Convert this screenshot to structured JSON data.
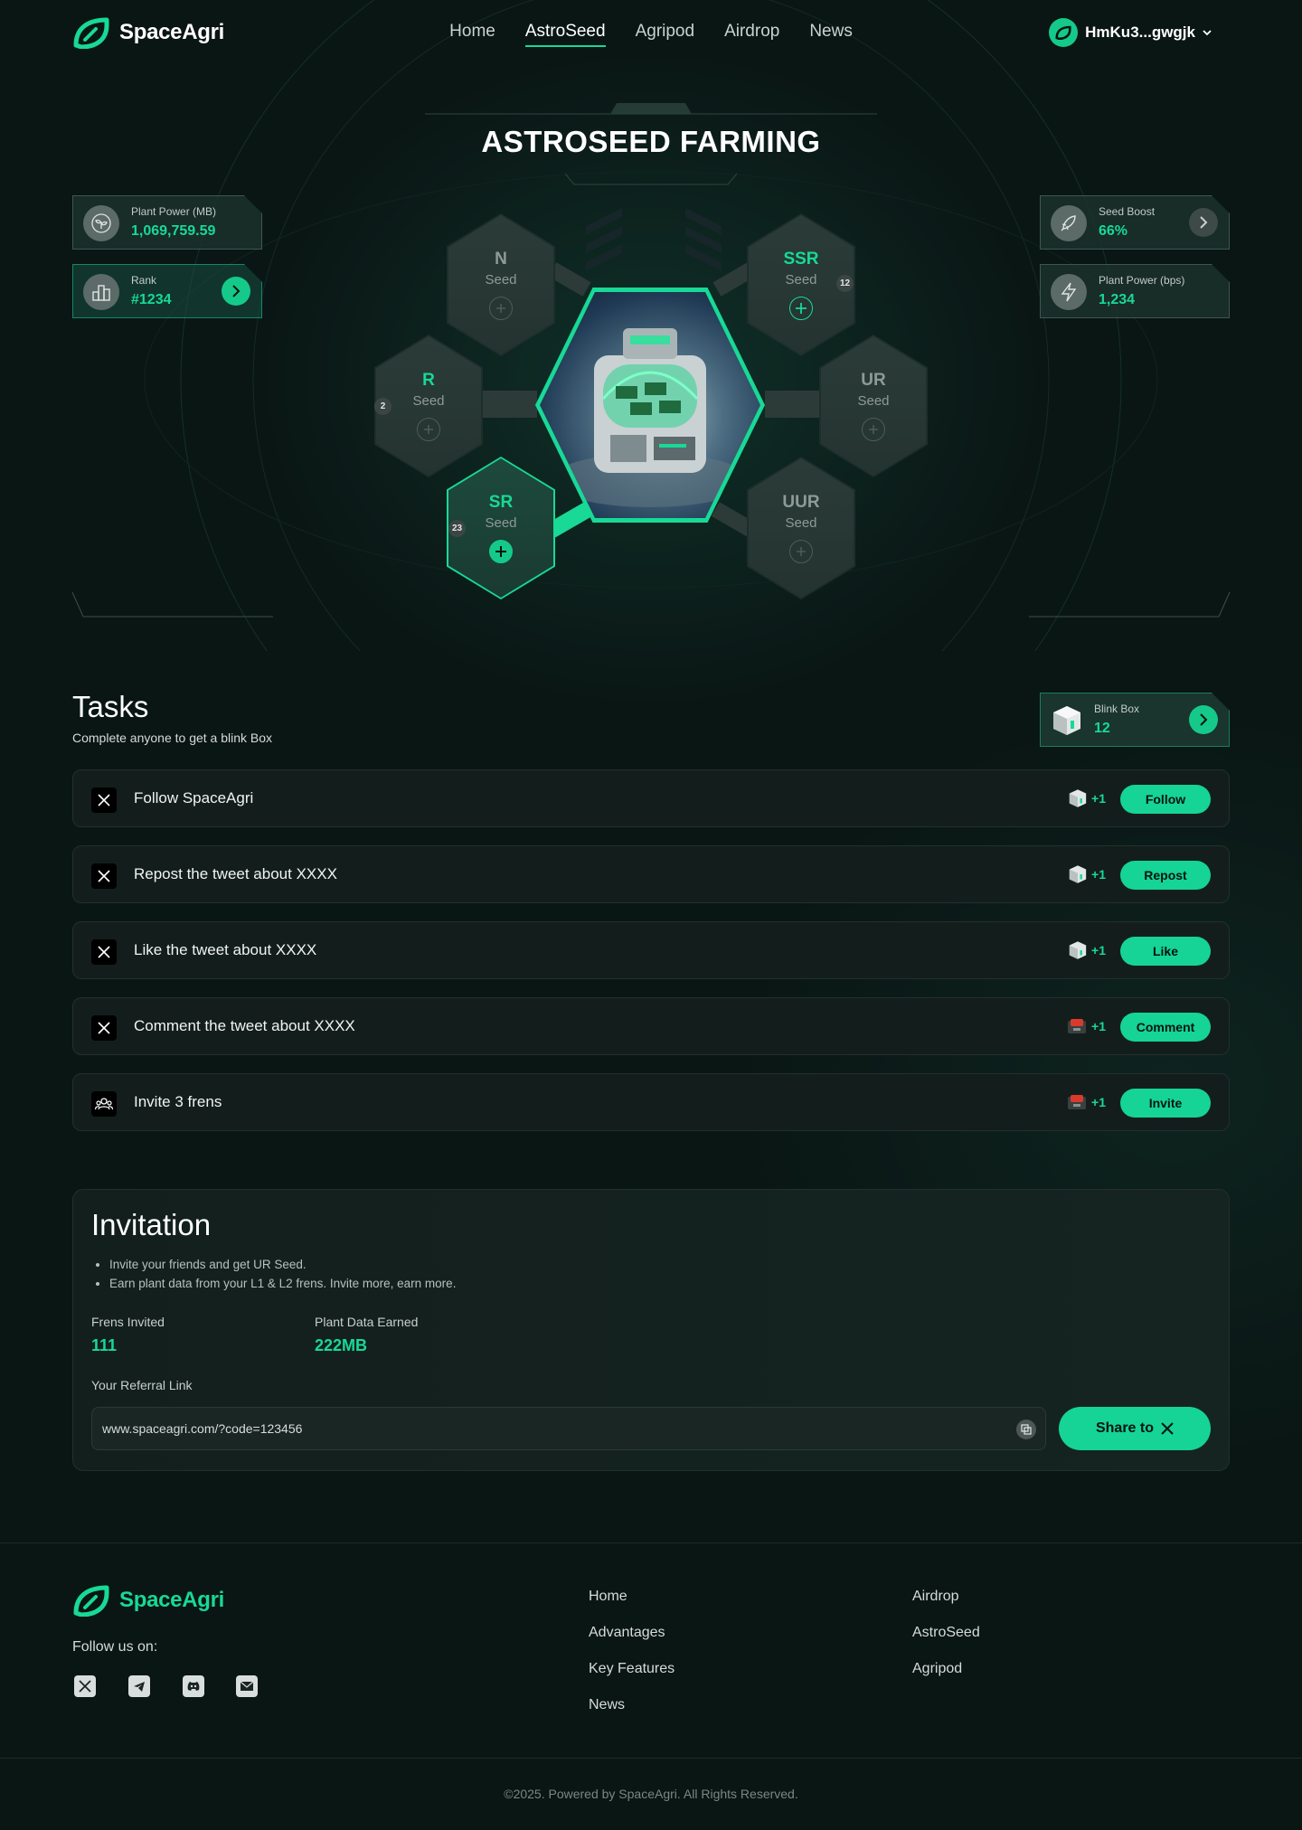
{
  "brand": {
    "name": "SpaceAgri",
    "accent": "#18d996",
    "background": "#0a1614"
  },
  "nav": {
    "items": [
      "Home",
      "AstroSeed",
      "Agripod",
      "Airdrop",
      "News"
    ],
    "active": "AstroSeed"
  },
  "wallet": {
    "address": "HmKu3...gwgjk",
    "icon": "leaf-logo-icon"
  },
  "farming": {
    "title": "ASTROSEED FARMING",
    "plant_power_mb": {
      "label": "Plant Power (MB)",
      "value": "1,069,759.59",
      "icon": "seedling-icon"
    },
    "rank": {
      "label": "Rank",
      "value": "#1234",
      "icon": "podium-icon"
    },
    "seed_boost": {
      "label": "Seed Boost",
      "value": "66%",
      "icon": "rocket-icon"
    },
    "plant_power_bps": {
      "label": "Plant Power (bps)",
      "value": "1,234",
      "icon": "lightning-icon"
    },
    "seed_word": "Seed",
    "seeds": [
      {
        "grade": "N",
        "count": "",
        "state": "empty"
      },
      {
        "grade": "SSR",
        "count": "12",
        "state": "available"
      },
      {
        "grade": "R",
        "count": "2",
        "state": "available"
      },
      {
        "grade": "UR",
        "count": "",
        "state": "empty"
      },
      {
        "grade": "SR",
        "count": "23",
        "state": "planted"
      },
      {
        "grade": "UUR",
        "count": "",
        "state": "empty"
      }
    ]
  },
  "tasks": {
    "title": "Tasks",
    "subtitle": "Complete anyone to get a blink Box",
    "blink_box": {
      "label": "Blink Box",
      "value": "12"
    },
    "items": [
      {
        "label": "Follow SpaceAgri",
        "reward": "+1",
        "button": "Follow",
        "icon": "x-logo-icon",
        "reward_icon": "blink-box-icon"
      },
      {
        "label": "Repost the tweet about XXXX",
        "reward": "+1",
        "button": "Repost",
        "icon": "x-logo-icon",
        "reward_icon": "blink-box-icon"
      },
      {
        "label": "Like the tweet about XXXX",
        "reward": "+1",
        "button": "Like",
        "icon": "x-logo-icon",
        "reward_icon": "blink-box-icon"
      },
      {
        "label": "Comment the tweet about XXXX",
        "reward": "+1",
        "button": "Comment",
        "icon": "x-logo-icon",
        "reward_icon": "red-box-icon"
      },
      {
        "label": "Invite 3 frens",
        "reward": "+1",
        "button": "Invite",
        "icon": "people-icon",
        "reward_icon": "red-box-icon"
      }
    ]
  },
  "invitation": {
    "title": "Invitation",
    "bullets": [
      "Invite your friends and get UR Seed.",
      "Earn plant data from your L1 & L2 frens. Invite more, earn more."
    ],
    "frens_invited": {
      "label": "Frens Invited",
      "value": "111"
    },
    "plant_data": {
      "label": "Plant Data Earned",
      "value": "222MB"
    },
    "referral_label": "Your Referral Link",
    "referral_link": "www.spaceagri.com/?code=123456",
    "share_label": "Share to"
  },
  "footer": {
    "brand": "SpaceAgri",
    "follow_label": "Follow us on:",
    "socials": [
      "x-icon",
      "telegram-icon",
      "discord-icon",
      "mail-icon"
    ],
    "col1": [
      "Home",
      "Advantages",
      "Key Features",
      "News"
    ],
    "col2": [
      "Airdrop",
      "AstroSeed",
      "Agripod"
    ],
    "copyright": "©2025. Powered by SpaceAgri. All Rights Reserved."
  }
}
